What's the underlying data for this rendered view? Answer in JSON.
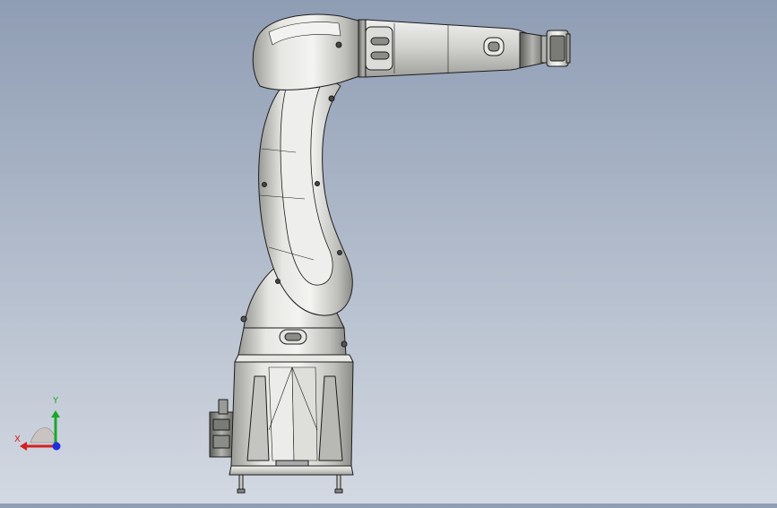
{
  "scene": {
    "background_top": "#8f9db4",
    "background_bottom": "#d3d9e2",
    "model_color": "#d9d9d6",
    "edge_color": "#1c1c1c"
  },
  "triad": {
    "x_label": "X",
    "y_label": "Y",
    "x_color": "#d42020",
    "y_color": "#18a82a",
    "z_color": "#1e2ee0"
  }
}
